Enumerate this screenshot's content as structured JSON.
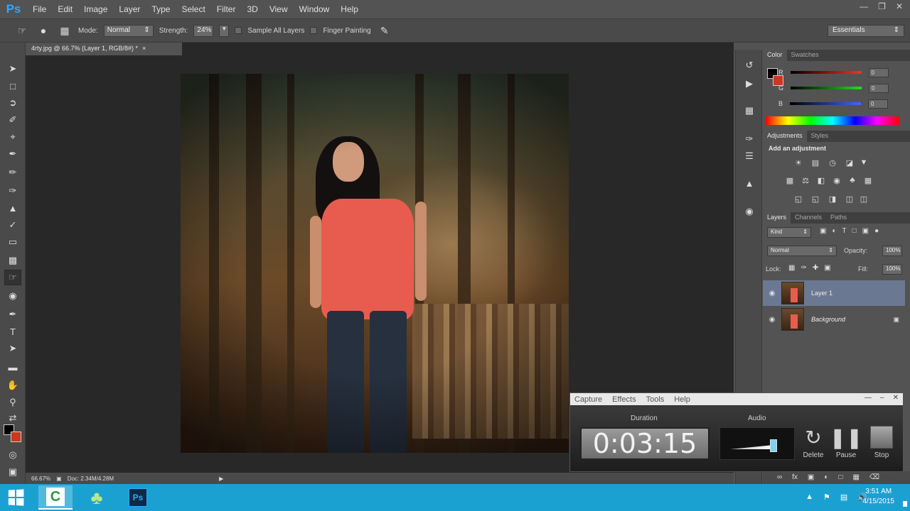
{
  "app": {
    "logo": "Ps"
  },
  "menu": [
    "File",
    "Edit",
    "Image",
    "Layer",
    "Type",
    "Select",
    "Filter",
    "3D",
    "View",
    "Window",
    "Help"
  ],
  "options": {
    "mode_label": "Mode:",
    "mode_value": "Normal",
    "strength_label": "Strength:",
    "strength_value": "24%",
    "sample_all_layers": "Sample All Layers",
    "finger_painting": "Finger Painting",
    "workspace": "Essentials"
  },
  "document": {
    "tab": "4rty.jpg @ 66.7% (Layer 1, RGB/8#) *",
    "zoom": "66.67%",
    "doc_size": "Doc: 2.34M/4.28M"
  },
  "colors": {
    "foreground": "#000000",
    "background": "#c8391f",
    "accent": "#31a8ff",
    "taskbar": "#1aa1d2",
    "selected_layer": "#6b7891"
  },
  "color_panel": {
    "tabs": [
      "Color",
      "Swatches"
    ],
    "channels": [
      {
        "label": "R",
        "value": "0",
        "color": "#ff2a2a"
      },
      {
        "label": "G",
        "value": "0",
        "color": "#22dd22"
      },
      {
        "label": "B",
        "value": "0",
        "color": "#3a6aff"
      }
    ]
  },
  "adjustments_panel": {
    "tabs": [
      "Adjustments",
      "Styles"
    ],
    "title": "Add an adjustment"
  },
  "layers_panel": {
    "tabs": [
      "Layers",
      "Channels",
      "Paths"
    ],
    "kind": "Kind",
    "blend_mode": "Normal",
    "opacity_label": "Opacity:",
    "opacity": "100%",
    "lock_label": "Lock:",
    "fill_label": "Fill:",
    "fill": "100%",
    "layers": [
      {
        "name": "Layer 1",
        "selected": true
      },
      {
        "name": "Background",
        "selected": false
      }
    ]
  },
  "capture": {
    "menu": [
      "Capture",
      "Effects",
      "Tools",
      "Help"
    ],
    "duration_label": "Duration",
    "duration": "0:03:15",
    "audio_label": "Audio",
    "audio_level": 0.8,
    "buttons": [
      "Delete",
      "Pause",
      "Stop"
    ]
  },
  "taskbar": {
    "time": "3:51 AM",
    "date": "4/15/2015",
    "apps": [
      "camtasia",
      "clover",
      "photoshop"
    ]
  }
}
